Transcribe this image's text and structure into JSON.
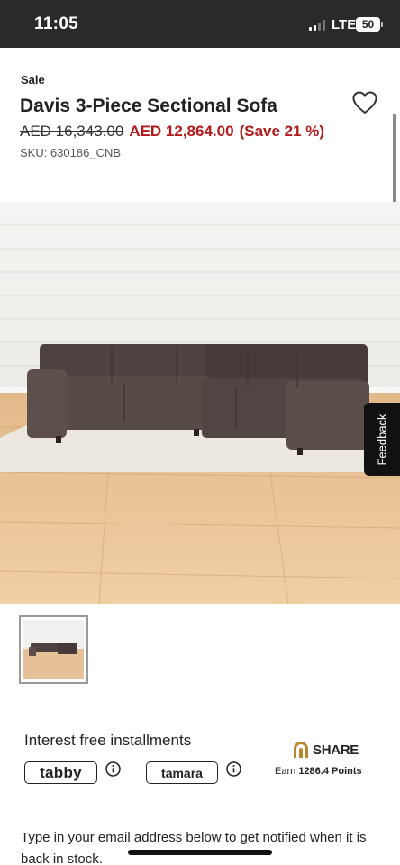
{
  "status_bar": {
    "time": "11:05",
    "network": "LTE",
    "battery": "50"
  },
  "product": {
    "sale_label": "Sale",
    "title": "Davis 3-Piece Sectional Sofa",
    "price_old": "AED 16,343.00",
    "price_new": "AED 12,864.00",
    "savings": "(Save 21 %)",
    "sku": "SKU: 630186_CNB"
  },
  "feedback": {
    "label": "Feedback"
  },
  "installments": {
    "heading": "Interest free installments",
    "providers": [
      {
        "name": "tabby"
      },
      {
        "name": "tamara"
      }
    ]
  },
  "share": {
    "label": "SHARE",
    "earn_prefix": "Earn",
    "points": "1286.4 Points"
  },
  "stock_notice": {
    "text": "Type in your email address below to get notified when it is back in stock."
  },
  "colors": {
    "sale_red": "#b3191a",
    "status_bar_bg": "#2a2a2a",
    "share_gold": "#b8862f"
  }
}
